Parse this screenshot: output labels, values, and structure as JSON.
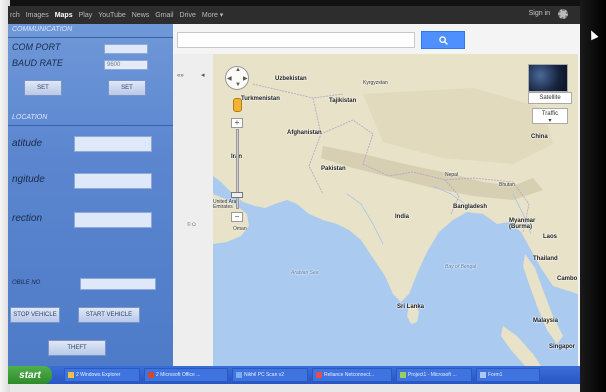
{
  "google_bar": {
    "links": [
      "rch",
      "Images",
      "Maps",
      "Play",
      "YouTube",
      "News",
      "Gmail",
      "Drive",
      "More ▾"
    ],
    "active": "Maps",
    "sign_in": "Sign in"
  },
  "panel": {
    "communication_heading": "COMMUNICATION",
    "com_port_label": "COM PORT",
    "baud_rate_label": "BAUD RATE",
    "baud_rate_value": "9600",
    "set_button_1": "SET",
    "set_button_2": "SET",
    "location_heading": "LOCATION",
    "latitude_label": "atitude",
    "longitude_label": "ngitude",
    "direction_label": "rection",
    "mobile_label": "OBILE NO",
    "stop_vehicle": "STOP VEHICLE",
    "start_vehicle": "START VEHICLE",
    "theft": "THEFT"
  },
  "map": {
    "side_toggle": "«»",
    "side_arrow": "◂",
    "side_link": "© Ω",
    "satellite_label": "Satellite",
    "traffic_label": "Traffic",
    "traffic_caret": "▾",
    "zoom_in": "+",
    "zoom_out": "−",
    "places": {
      "uzbekistan": "Uzbekistan",
      "kyrgyzstan": "Kyrgyzstan",
      "turkmenistan": "Turkmenistan",
      "tajikistan": "Tajikistan",
      "afghanistan": "Afghanistan",
      "pakistan": "Pakistan",
      "iran": "Iran",
      "china": "China",
      "india": "India",
      "nepal": "Nepal",
      "bhutan": "Bhutan",
      "bangladesh": "Bangladesh",
      "myanmar": "Myanmar (Burma)",
      "laos": "Laos",
      "thailand": "Thailand",
      "cambodia": "Cambo",
      "sri_lanka": "Sri Lanka",
      "malaysia": "Malaysia",
      "singapore": "Singapor",
      "uae": "United Arab Emirates",
      "oman": "Oman",
      "bay_of_bengal": "Bay of Bengal",
      "arabian_sea": "Arabian Sea"
    }
  },
  "taskbar": {
    "start": "start",
    "tasks": [
      "2 Windows Explorer",
      "2 Microsoft Office ...",
      "Nikhil PC Scan v2",
      "Reliance Netconnect...",
      "Project1 - Microsoft ...",
      "Form1"
    ]
  },
  "colors": {
    "panel_blue": "#5b86cf",
    "map_water": "#aacaf0",
    "map_land": "#e7e2c8",
    "search_button": "#4d90fe",
    "taskbar": "#2856c4",
    "start_green": "#3a9a35"
  }
}
